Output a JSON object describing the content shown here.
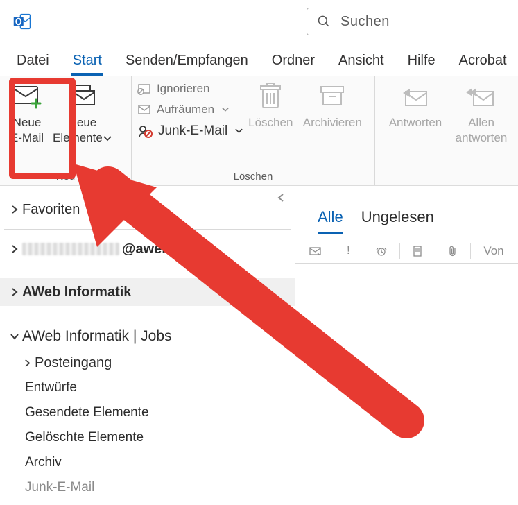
{
  "search": {
    "placeholder": "Suchen"
  },
  "tabs": {
    "datei": "Datei",
    "start": "Start",
    "senden": "Senden/Empfangen",
    "ordner": "Ordner",
    "ansicht": "Ansicht",
    "hilfe": "Hilfe",
    "acrobat": "Acrobat"
  },
  "ribbon": {
    "neu_caption": "Neu",
    "neue_email_l1": "Neue",
    "neue_email_l2": "E-Mail",
    "neue_elem_l1": "Neue",
    "neue_elem_l2": "Elemente",
    "loeschen_caption": "Löschen",
    "ignorieren": "Ignorieren",
    "aufraeumen": "Aufräumen",
    "junk": "Junk-E-Mail",
    "loeschen": "Löschen",
    "archivieren": "Archivieren",
    "antworten": "Antworten",
    "allen_l1": "Allen",
    "allen_l2": "antworten"
  },
  "nav": {
    "favoriten": "Favoriten",
    "account_suffix": "@aweb.ch",
    "aweb_info": "AWeb Informatik",
    "aweb_jobs": "AWeb Informatik | Jobs",
    "posteingang": "Posteingang",
    "entwuerfe": "Entwürfe",
    "gesendete": "Gesendete Elemente",
    "geloeschte": "Gelöschte Elemente",
    "archiv": "Archiv",
    "junk": "Junk-E-Mail"
  },
  "filter": {
    "alle": "Alle",
    "ungelesen": "Ungelesen"
  },
  "msgbar": {
    "von": "Von"
  }
}
